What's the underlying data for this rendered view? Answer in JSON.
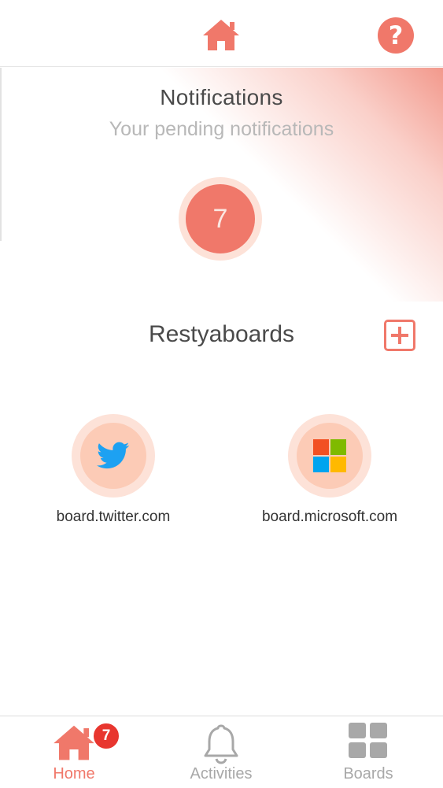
{
  "header": {
    "home_icon": "home-icon",
    "help_icon": "help-icon",
    "help_glyph": "?"
  },
  "notifications": {
    "title": "Notifications",
    "subtitle": "Your pending notifications",
    "count": "7"
  },
  "boards_section": {
    "title": "Restyaboards",
    "add_icon": "plus-square-icon",
    "boards": [
      {
        "label": "board.twitter.com",
        "icon": "twitter-icon"
      },
      {
        "label": "board.microsoft.com",
        "icon": "microsoft-icon"
      }
    ]
  },
  "bottom_nav": {
    "items": [
      {
        "label": "Home",
        "icon": "home-icon",
        "badge": "7",
        "active": true
      },
      {
        "label": "Activities",
        "icon": "bell-icon",
        "active": false
      },
      {
        "label": "Boards",
        "icon": "grid-icon",
        "active": false
      }
    ]
  },
  "colors": {
    "accent": "#f0786a",
    "accent_light": "#fde2d8",
    "badge": "#e8362f",
    "twitter": "#1da1f2",
    "ms_red": "#f25022",
    "ms_green": "#7fba00",
    "ms_blue": "#00a4ef",
    "ms_yellow": "#ffb900"
  }
}
